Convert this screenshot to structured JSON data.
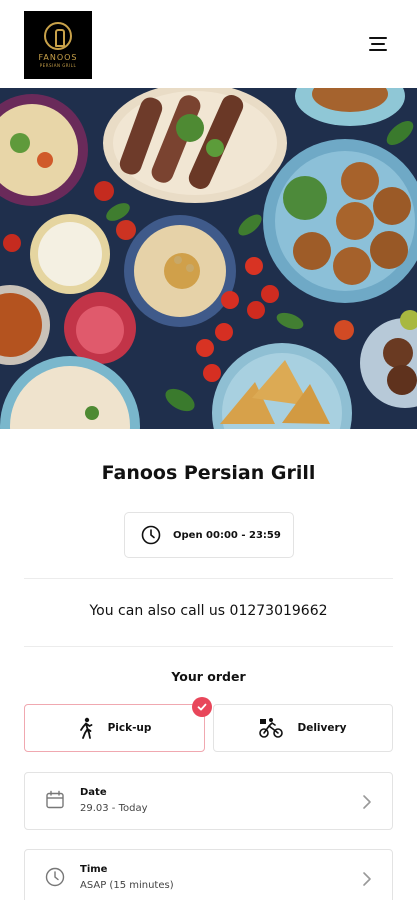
{
  "header": {
    "logo_name": "FANOOS",
    "logo_sub": "PERSIAN GRILL"
  },
  "restaurant": {
    "name": "Fanoos Persian Grill",
    "hours": "Open 00:00 - 23:59",
    "call_text": "You can also call us 01273019662"
  },
  "order": {
    "title": "Your order",
    "pickup_label": "Pick-up",
    "delivery_label": "Delivery",
    "selected": "Pick-up",
    "date_label": "Date",
    "date_value": "29.03 - Today",
    "time_label": "Time",
    "time_value": "ASAP (15 minutes)"
  },
  "colors": {
    "accent": "#e8465a",
    "selected_border": "#f0a8b0",
    "logo_gold": "#c9a24a"
  },
  "icons": [
    "menu-icon",
    "clock-icon",
    "walking-person-icon",
    "delivery-bike-icon",
    "check-icon",
    "calendar-icon",
    "chevron-right-icon"
  ]
}
